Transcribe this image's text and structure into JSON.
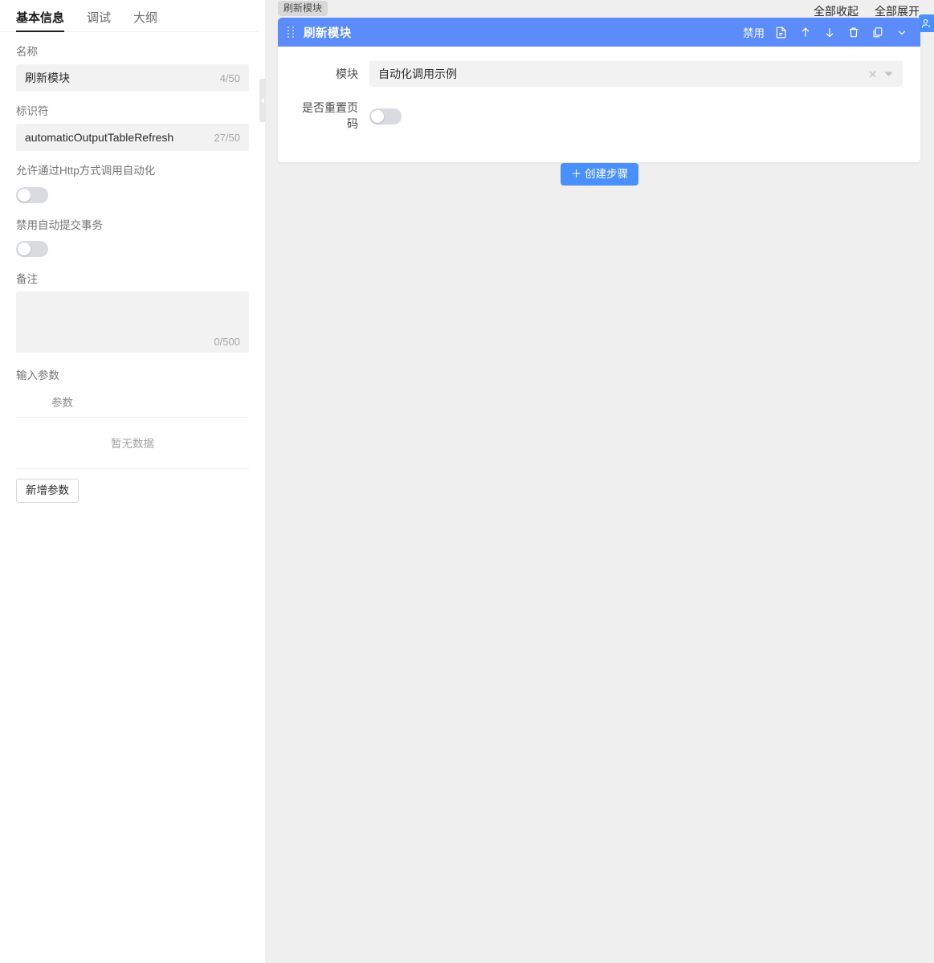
{
  "left_panel": {
    "tabs": [
      {
        "label": "基本信息",
        "active": true
      },
      {
        "label": "调试",
        "active": false
      },
      {
        "label": "大纲",
        "active": false
      }
    ],
    "fields": {
      "name_label": "名称",
      "name_value": "刷新模块",
      "name_counter": "4/50",
      "identifier_label": "标识符",
      "identifier_value": "automaticOutputTableRefresh",
      "identifier_counter": "27/50",
      "http_label": "允许通过Http方式调用自动化",
      "http_enabled": false,
      "autocommit_label": "禁用自动提交事务",
      "autocommit_enabled": false,
      "remark_label": "备注",
      "remark_value": "",
      "remark_counter": "0/500"
    },
    "params": {
      "section_title": "输入参数",
      "columns": [
        "参数"
      ],
      "rows": [],
      "empty_text": "暂无数据",
      "add_button": "新增参数"
    }
  },
  "canvas": {
    "topbar": {
      "collapse_all": "全部收起",
      "expand_all": "全部展开"
    },
    "step_tag": "刷新模块",
    "card": {
      "title": "刷新模块",
      "disable_label": "禁用",
      "icons": [
        "note-icon",
        "arrow-up-icon",
        "arrow-down-icon",
        "trash-icon",
        "copy-icon",
        "chevron-down-icon"
      ],
      "fields": {
        "module_label": "模块",
        "module_value": "自动化调用示例",
        "reset_page_label": "是否重置页码",
        "reset_page_enabled": false
      }
    },
    "create_step_button": "＋ 创建步骤"
  },
  "colors": {
    "primary": "#5b8cfa",
    "button": "#4a90fc",
    "canvas_bg": "#efefef",
    "input_bg": "#f2f2f3",
    "tag_bg": "#d8d8d8"
  }
}
